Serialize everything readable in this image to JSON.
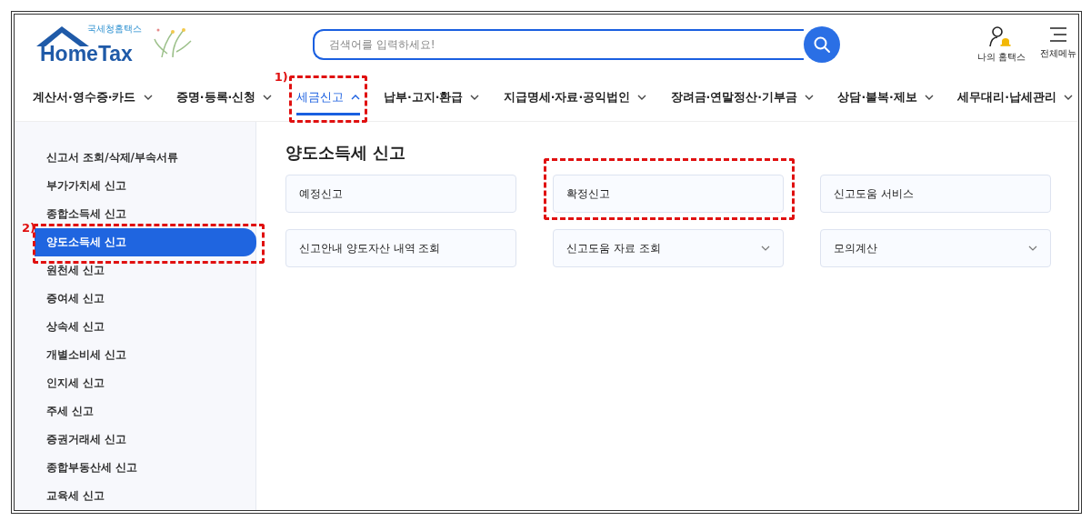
{
  "header": {
    "logo": {
      "subtitle": "국세청홈택스",
      "title": "HomeTax"
    },
    "search": {
      "placeholder": "검색어를 입력하세요!"
    },
    "utilities": [
      {
        "kind": "my",
        "label": "나의 홈택스"
      },
      {
        "kind": "menu",
        "label": "전체메뉴"
      }
    ]
  },
  "nav": [
    {
      "label": "계산서·영수증·카드",
      "selected": false
    },
    {
      "label": "증명·등록·신청",
      "selected": false
    },
    {
      "label": "세금신고",
      "selected": true,
      "annotation": "1)"
    },
    {
      "label": "납부·고지·환급",
      "selected": false
    },
    {
      "label": "지급명세·자료·공익법인",
      "selected": false
    },
    {
      "label": "장려금·연말정산·기부금",
      "selected": false
    },
    {
      "label": "상담·불복·제보",
      "selected": false
    },
    {
      "label": "세무대리·납세관리",
      "selected": false
    }
  ],
  "sidebar": {
    "items": [
      {
        "label": "신고서 조회/삭제/부속서류",
        "selected": false
      },
      {
        "label": "부가가치세 신고",
        "selected": false
      },
      {
        "label": "종합소득세 신고",
        "selected": false
      },
      {
        "label": "양도소득세 신고",
        "selected": true,
        "annotation": "2)"
      },
      {
        "label": "원천세 신고",
        "selected": false
      },
      {
        "label": "증여세 신고",
        "selected": false
      },
      {
        "label": "상속세 신고",
        "selected": false
      },
      {
        "label": "개별소비세 신고",
        "selected": false
      },
      {
        "label": "인지세 신고",
        "selected": false
      },
      {
        "label": "주세 신고",
        "selected": false
      },
      {
        "label": "증권거래세 신고",
        "selected": false
      },
      {
        "label": "종합부동산세 신고",
        "selected": false
      },
      {
        "label": "교육세 신고",
        "selected": false
      }
    ]
  },
  "main": {
    "title": "양도소득세 신고",
    "cards": [
      {
        "label": "예정신고",
        "kind": "link"
      },
      {
        "label": "확정신고",
        "kind": "link",
        "annotated": true
      },
      {
        "label": "신고도움 서비스",
        "kind": "link"
      },
      {
        "label": "신고안내 양도자산 내역 조회",
        "kind": "link"
      },
      {
        "label": "신고도움 자료 조회",
        "kind": "dropdown"
      },
      {
        "label": "모의계산",
        "kind": "dropdown"
      }
    ]
  }
}
